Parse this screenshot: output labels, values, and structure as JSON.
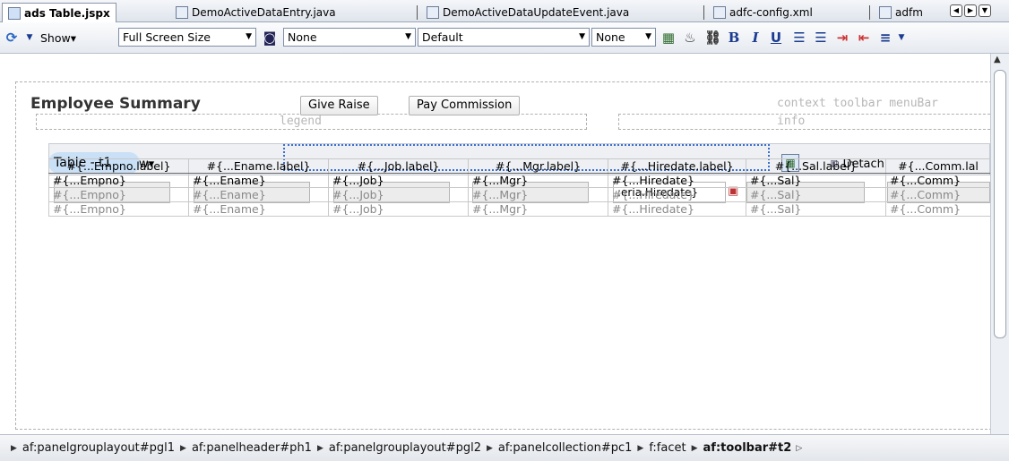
{
  "tabs": [
    {
      "label": "ads Table.jspx",
      "active": true,
      "icon": "jspx-file-icon"
    },
    {
      "label": "DemoActiveDataEntry.java",
      "active": false,
      "icon": "java-file-icon"
    },
    {
      "label": "DemoActiveDataUpdateEvent.java",
      "active": false,
      "icon": "java-file-icon"
    },
    {
      "label": "adfc-config.xml",
      "active": false,
      "icon": "xml-file-icon"
    },
    {
      "label": "adfm",
      "active": false,
      "icon": "xml-file-icon"
    }
  ],
  "toolbar": {
    "show_label": "Show",
    "size_combo": "Full Screen Size",
    "none_combo": "None",
    "default_combo": "Default",
    "none_combo2": "None"
  },
  "panel": {
    "header": "Employee Summary",
    "legend": "legend",
    "info": "info",
    "context_facets": "context toolbar menuBar",
    "table_badge": "Table - t1",
    "view_menu": "w",
    "give_raise": "Give Raise",
    "pay_commission": "Pay Commission",
    "detach": "Detach",
    "hiredate_filter": ":eria.Hiredate}"
  },
  "table": {
    "headers": [
      "#{...Empno.label}",
      "#{...Ename.label}",
      "#{...Job.label}",
      "#{...Mgr.label}",
      "#{...Hiredate.label}",
      "#{...Sal.label}",
      "#{...Comm.lal"
    ],
    "rows": [
      [
        "#{...Empno}",
        "#{...Ename}",
        "#{...Job}",
        "#{...Mgr}",
        "#{...Hiredate}",
        "#{...Sal}",
        "#{...Comm}"
      ],
      [
        "#{...Empno}",
        "#{...Ename}",
        "#{...Job}",
        "#{...Mgr}",
        "#{...Hiredate}",
        "#{...Sal}",
        "#{...Comm}"
      ],
      [
        "#{...Empno}",
        "#{...Ename}",
        "#{...Job}",
        "#{...Mgr}",
        "#{...Hiredate}",
        "#{...Sal}",
        "#{...Comm}"
      ]
    ]
  },
  "breadcrumb": [
    "af:panelgrouplayout#pgl1",
    "af:panelheader#ph1",
    "af:panelgrouplayout#pgl2",
    "af:panelcollection#pc1",
    "f:facet",
    "af:toolbar#t2"
  ]
}
